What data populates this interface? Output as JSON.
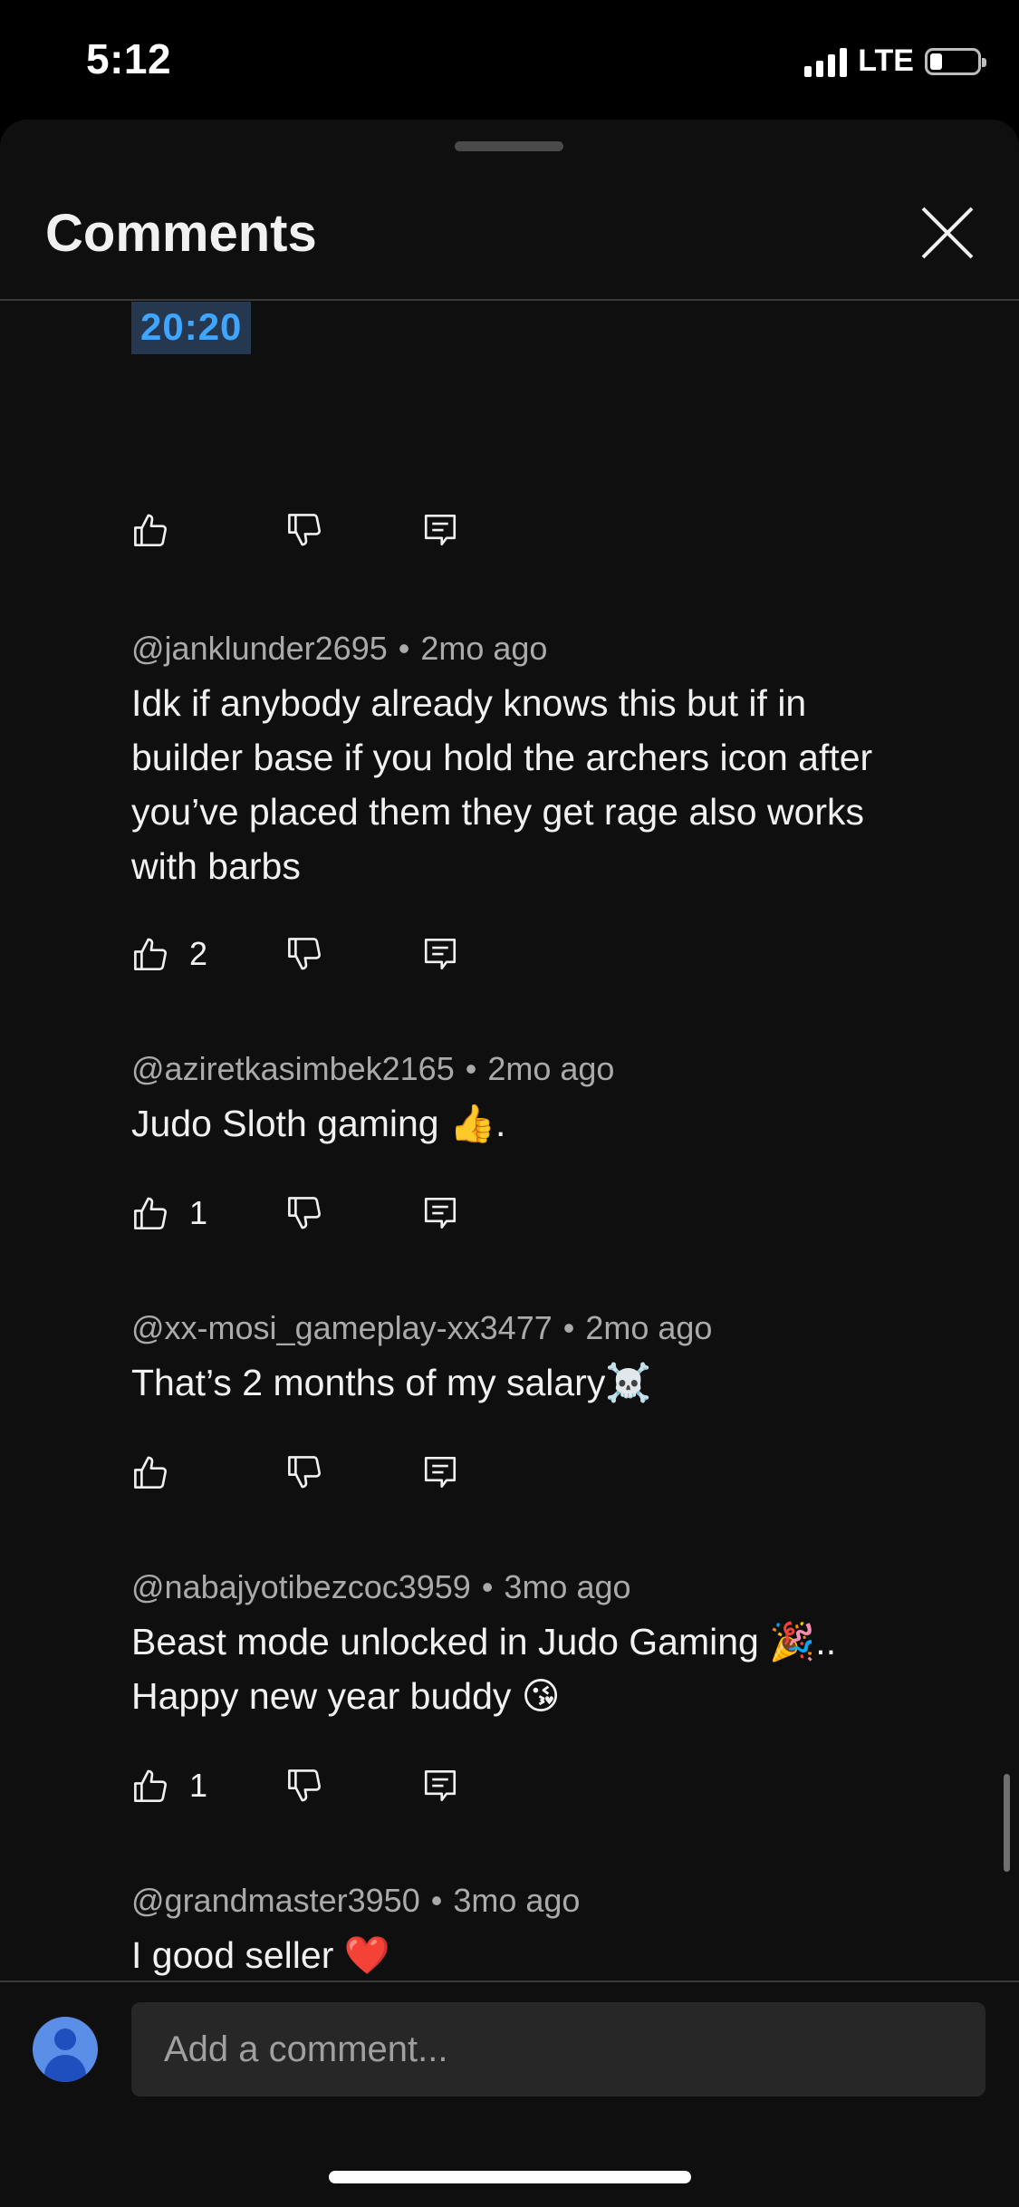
{
  "status_bar": {
    "time": "5:12",
    "network": "LTE"
  },
  "sheet": {
    "title": "Comments",
    "close_icon": "close-icon"
  },
  "timestamp_link": "20:20",
  "comments": [
    {
      "author": "@janklunder2695",
      "time": "2mo ago",
      "text_lines": [
        "Idk if anybody already knows this but if in",
        "builder base if you hold the archers icon after",
        "you’ve placed them they get rage also works",
        "with barbs"
      ],
      "likes": "2"
    },
    {
      "author": "@aziretkasimbek2165",
      "time": "2mo ago",
      "text_lines": [
        "Judo Sloth gaming 👍."
      ],
      "likes": "1"
    },
    {
      "author": "@xx-mosi_gameplay-xx3477",
      "time": "2mo ago",
      "text_lines": [
        "That’s 2 months of my salary☠️"
      ],
      "likes": ""
    },
    {
      "author": "@nabajyotibezcoc3959",
      "time": "3mo ago",
      "text_lines": [
        "Beast mode unlocked in Judo Gaming 🎉..",
        "Happy new year buddy 😘"
      ],
      "likes": "1"
    },
    {
      "author": "@grandmaster3950",
      "time": "3mo ago",
      "text_lines": [
        "I good seller ❤️"
      ],
      "likes": ""
    }
  ],
  "compose": {
    "placeholder": "Add a comment..."
  },
  "colors": {
    "background": "#0f0f0f",
    "accent_link": "#3ea6ff",
    "link_bg": "#263850",
    "text": "#f1f1f1",
    "meta": "#aaaaaa",
    "avatar": "#5b8ee6"
  }
}
